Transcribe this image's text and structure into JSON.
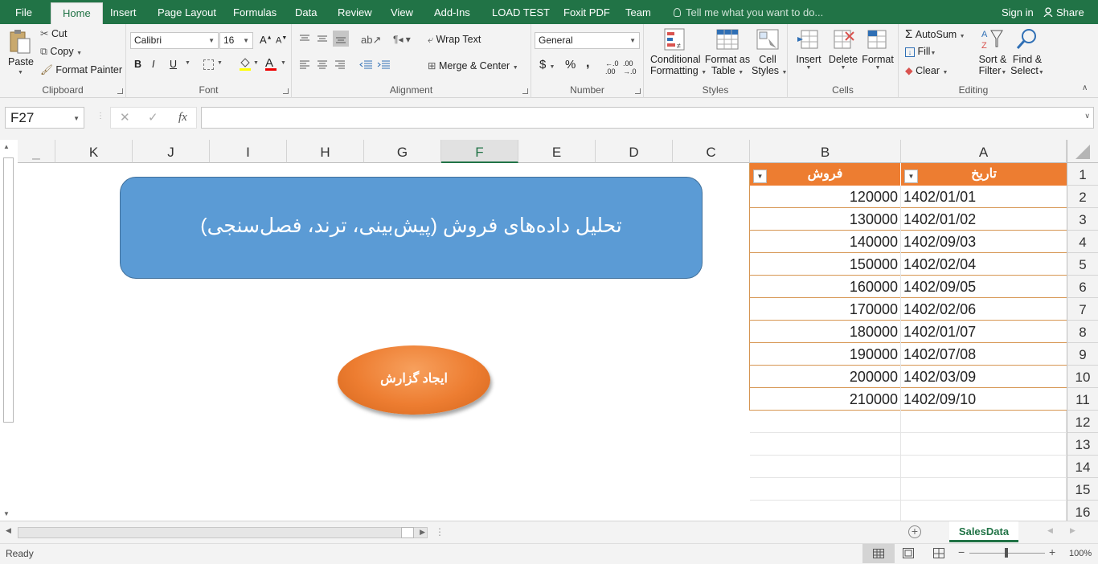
{
  "tabs": [
    "File",
    "Home",
    "Insert",
    "Page Layout",
    "Formulas",
    "Data",
    "Review",
    "View",
    "Add-Ins",
    "LOAD TEST",
    "Foxit PDF",
    "Team"
  ],
  "tell_me": "Tell me what you want to do...",
  "sign_in": "Sign in",
  "share": "Share",
  "clipboard": {
    "paste": "Paste",
    "cut": "Cut",
    "copy": "Copy",
    "format_painter": "Format Painter",
    "label": "Clipboard"
  },
  "font": {
    "name": "Calibri",
    "size": "16",
    "bold": "B",
    "italic": "I",
    "underline": "U",
    "label": "Font"
  },
  "alignment": {
    "wrap": "Wrap Text",
    "merge": "Merge & Center",
    "label": "Alignment"
  },
  "number": {
    "format": "General",
    "currency": "$",
    "percent": "%",
    "comma": ",",
    "label": "Number"
  },
  "styles": {
    "conditional1": "Conditional",
    "conditional2": "Formatting",
    "format_table1": "Format as",
    "format_table2": "Table",
    "cell_styles1": "Cell",
    "cell_styles2": "Styles",
    "label": "Styles"
  },
  "cells": {
    "insert": "Insert",
    "delete": "Delete",
    "format": "Format",
    "label": "Cells"
  },
  "editing": {
    "autosum": "AutoSum",
    "fill": "Fill",
    "clear": "Clear",
    "sort1": "Sort &",
    "sort2": "Filter",
    "find1": "Find &",
    "find2": "Select",
    "label": "Editing"
  },
  "name_box": "F27",
  "fx": "fx",
  "columns": [
    "A",
    "B",
    "C",
    "D",
    "E",
    "F",
    "G",
    "H",
    "I",
    "J",
    "K"
  ],
  "selected_column": "F",
  "rows": [
    "1",
    "2",
    "3",
    "4",
    "5",
    "6",
    "7",
    "8",
    "9",
    "10",
    "11",
    "12",
    "13",
    "14",
    "15",
    "16"
  ],
  "table": {
    "headers": [
      "تاریخ",
      "فروش"
    ],
    "dates": [
      "1402/01/01",
      "1402/01/02",
      "1402/09/03",
      "1402/02/04",
      "1402/09/05",
      "1402/02/06",
      "1402/01/07",
      "1402/07/08",
      "1402/03/09",
      "1402/09/10"
    ],
    "sales": [
      "120000",
      "130000",
      "140000",
      "150000",
      "160000",
      "170000",
      "180000",
      "190000",
      "200000",
      "210000"
    ]
  },
  "title_box": "تحلیل داده‌های فروش (پیش‌بینی، ترند، فصل‌سنجی)",
  "report_button": "ایجاد گزارش",
  "sheet_tab": "SalesData",
  "status": "Ready",
  "zoom": "100%",
  "colors": {
    "excel_green": "#217346",
    "table_header": "#ed7d31",
    "title_fill": "#5b9bd5"
  }
}
